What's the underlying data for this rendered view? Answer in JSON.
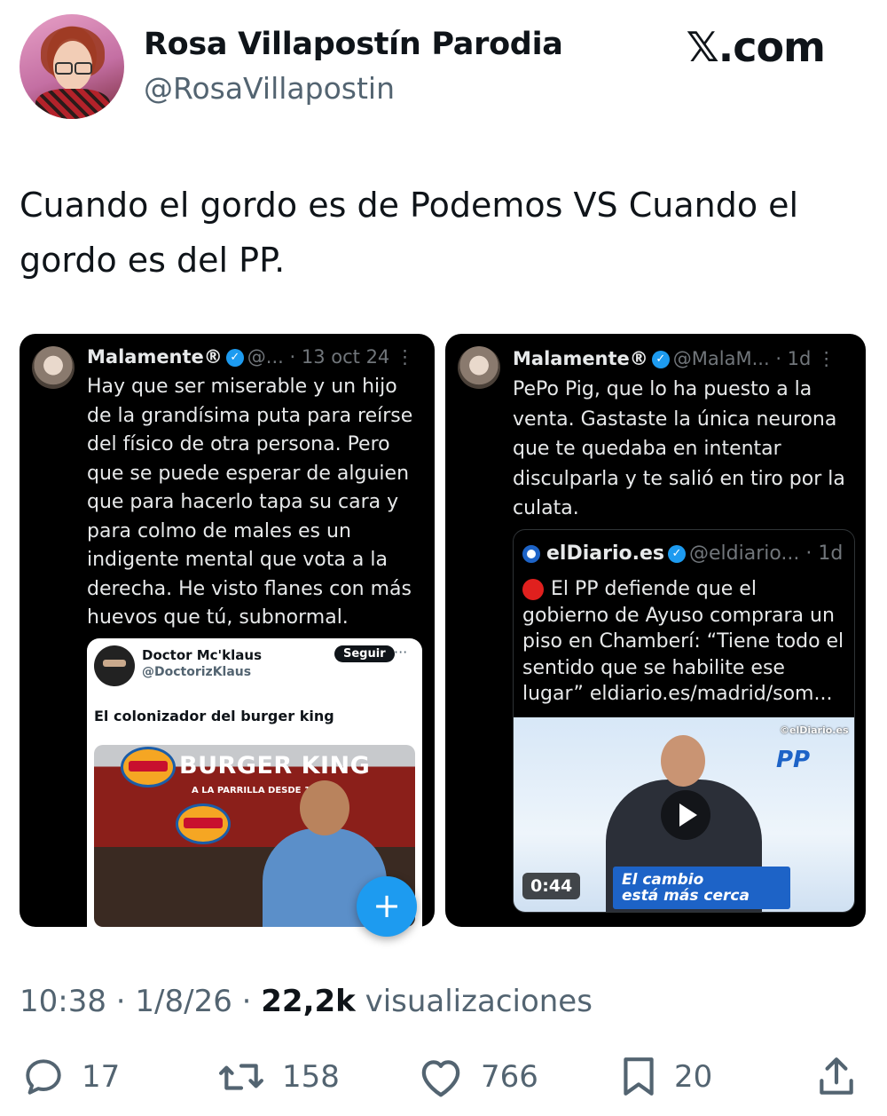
{
  "author": {
    "name": "Rosa Villapostín Parodia",
    "handle": "@RosaVillapostin"
  },
  "brand": "𝕏.com",
  "tweet_text": "Cuando el gordo es de Podemos VS Cuando el gordo es del PP.",
  "left_card": {
    "name": "Malamente®",
    "handle": "@...",
    "time": "· 13 oct 24",
    "text": "Hay que ser miserable y un hijo de la grandísima puta para reírse del físico de otra persona. Pero que se puede esperar de alguien que para hacerlo tapa su cara y para colmo de males es un indigente mental que vota a la derecha. He visto flanes con más huevos que tú, subnormal.",
    "embedded": {
      "name": "Doctor Mc'klaus",
      "handle": "@DoctorizKlaus",
      "follow_label": "Seguir",
      "text": "El colonizador del burger king",
      "sign_text": "BURGER KING",
      "sub_sign": "A LA PARRILLA DESDE 1954"
    },
    "fab_label": "+"
  },
  "right_card": {
    "name": "Malamente®",
    "handle": "@MalaM...",
    "time": "· 1d",
    "text": "PePo Pig, que lo ha puesto a la venta. Gastaste la única neurona que te quedaba en intentar disculparla y te salió en tiro por la culata.",
    "quote": {
      "name": "elDiario.es",
      "handle": "@eldiario...",
      "time": "· 1d",
      "text": "El PP defiende que el gobierno de Ayuso comprara un piso en Chamberí: “Tiene todo el sentido que se habilite ese lugar” eldiario.es/madrid/som...",
      "video": {
        "duration": "0:44",
        "banner_line1": "El cambio",
        "banner_line2": "está más cerca",
        "watermark": "©elDiario.es",
        "party_logo": "PP"
      }
    }
  },
  "meta": {
    "time": "10:38 · 1/8/26 · ",
    "views": "22,2k",
    "views_label": " visualizaciones"
  },
  "actions": {
    "replies": "17",
    "retweets": "158",
    "likes": "766",
    "bookmarks": "20"
  },
  "colors": {
    "accent": "#1d9bf0",
    "secondary_text": "#536471",
    "card_bg": "#000000",
    "pp_blue": "#1d63c7"
  }
}
